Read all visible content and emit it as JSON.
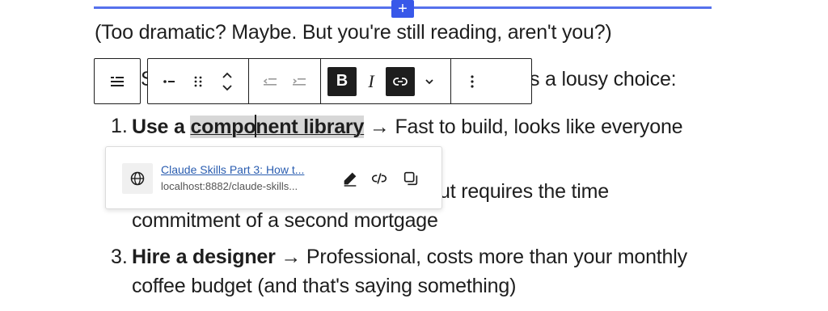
{
  "editor": {
    "inserter_label": "+",
    "intro_paragraph": "(Too dramatic? Maybe. But you're still reading, aren't you?)",
    "clipped_paragraph_start": "S",
    "clipped_paragraph_end": "s a lousy choice:"
  },
  "list": {
    "items": [
      {
        "number": "1.",
        "bold_lead_before_link": "Use a ",
        "link_before_caret": "compo",
        "link_after_caret": "nent library",
        "rest": " → Fast to build, looks like everyone"
      },
      {
        "number": "",
        "line_1_visible": "ut requires the time",
        "line_2": "commitment of a second mortgage"
      },
      {
        "number": "3.",
        "bold_lead": "Hire a designer",
        "rest": " → Professional, costs more than your monthly",
        "line_2": "coffee budget (and that's saying something)"
      }
    ]
  },
  "toolbar": {
    "parent_block_icon": "list-view-icon",
    "buttons": [
      {
        "name": "bullet-dash-icon",
        "glyph": "•–"
      },
      {
        "name": "drag-handle-icon",
        "glyph": "⠿"
      },
      {
        "name": "move-up-down-icon",
        "glyph": "⌃⌄"
      },
      {
        "name": "outdent-icon",
        "glyph": "⇤"
      },
      {
        "name": "indent-icon",
        "glyph": "⇥"
      },
      {
        "name": "bold-icon",
        "glyph": "B"
      },
      {
        "name": "italic-icon",
        "glyph": "I"
      },
      {
        "name": "link-icon",
        "glyph": "⊂⊃"
      },
      {
        "name": "more-formats-icon",
        "glyph": "⌄"
      },
      {
        "name": "options-icon",
        "glyph": "⋮"
      }
    ]
  },
  "link_popover": {
    "title": "Claude Skills Part 3: How t...",
    "url": "localhost:8882/claude-skills...",
    "icons": [
      "globe-icon",
      "edit-pencil-icon",
      "unlink-icon",
      "copy-icon"
    ]
  },
  "colors": {
    "accent": "#3858e9",
    "text": "#1e1e1e",
    "link": "#2a5db0",
    "selection": "#d7d7d7"
  }
}
